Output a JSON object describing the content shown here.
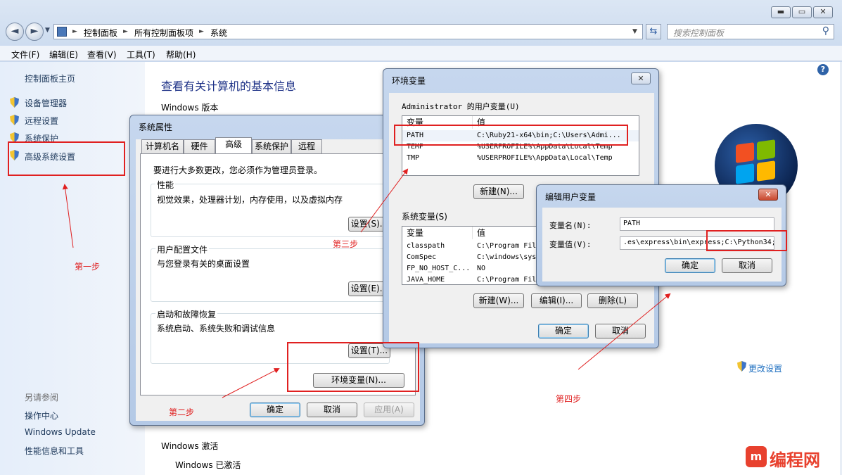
{
  "window": {
    "controls": {
      "min": "▬",
      "max": "▭",
      "close": "✕"
    },
    "nav": {
      "back": "◄",
      "forward": "►"
    },
    "breadcrumb": {
      "sep": "►",
      "item1": "控制面板",
      "item2": "所有控制面板项",
      "item3": "系统"
    },
    "search_placeholder": "搜索控制面板",
    "menu": [
      "文件(F)",
      "编辑(E)",
      "查看(V)",
      "工具(T)",
      "帮助(H)"
    ]
  },
  "sidebar": {
    "home": "控制面板主页",
    "items": [
      "设备管理器",
      "远程设置",
      "系统保护",
      "高级系统设置"
    ],
    "see_also_title": "另请参阅",
    "see_also": [
      "操作中心",
      "Windows Update",
      "性能信息和工具"
    ]
  },
  "main": {
    "title": "查看有关计算机的基本信息",
    "windows_edition": "Windows 版本",
    "activation_title": "Windows 激活",
    "activation_status": "Windows 已激活",
    "change_settings": "更改设置",
    "help": "?"
  },
  "sysprops": {
    "title": "系统属性",
    "tabs": [
      "计算机名",
      "硬件",
      "高级",
      "系统保护",
      "远程"
    ],
    "admin_note": "要进行大多数更改，您必须作为管理员登录。",
    "perf_title": "性能",
    "perf_desc": "视觉效果，处理器计划，内存使用，以及虚拟内存",
    "profile_title": "用户配置文件",
    "profile_desc": "与您登录有关的桌面设置",
    "startup_title": "启动和故障恢复",
    "startup_desc": "系统启动、系统失败和调试信息",
    "settings_s": "设置(S)...",
    "settings_e": "设置(E)...",
    "settings_t": "设置(T)...",
    "env_button": "环境变量(N)...",
    "ok": "确定",
    "cancel": "取消",
    "apply": "应用(A)"
  },
  "envvars": {
    "title": "环境变量",
    "user_group": "Administrator 的用户变量(U)",
    "col_var": "变量",
    "col_val": "值",
    "user_vars": [
      {
        "name": "PATH",
        "value": "C:\\Ruby21-x64\\bin;C:\\Users\\Admi..."
      },
      {
        "name": "TEMP",
        "value": "%USERPROFILE%\\AppData\\Local\\Temp"
      },
      {
        "name": "TMP",
        "value": "%USERPROFILE%\\AppData\\Local\\Temp"
      }
    ],
    "new_u": "新建(N)...",
    "system_group": "系统变量(S)",
    "sys_vars": [
      {
        "name": "classpath",
        "value": "C:\\Program Fil"
      },
      {
        "name": "ComSpec",
        "value": "C:\\windows\\sys"
      },
      {
        "name": "FP_NO_HOST_C...",
        "value": "NO"
      },
      {
        "name": "JAVA_HOME",
        "value": "C:\\Program Fil"
      }
    ],
    "new_w": "新建(W)...",
    "edit_i": "编辑(I)...",
    "delete_l": "删除(L)",
    "ok": "确定",
    "cancel": "取消"
  },
  "edituser": {
    "title": "编辑用户变量",
    "name_label": "变量名(N):",
    "name_value": "PATH",
    "value_label": "变量值(V):",
    "value_value": ".es\\express\\bin\\express;C:\\Python34;",
    "ok": "确定",
    "cancel": "取消"
  },
  "annotations": {
    "step1": "第一步",
    "step2": "第二步",
    "step3": "第三步",
    "step4": "第四步"
  },
  "watermark": {
    "text": "编程网"
  },
  "colors": {
    "annotation_red": "#e02020",
    "link_blue": "#1e395b",
    "title_blue": "#1e3287"
  }
}
